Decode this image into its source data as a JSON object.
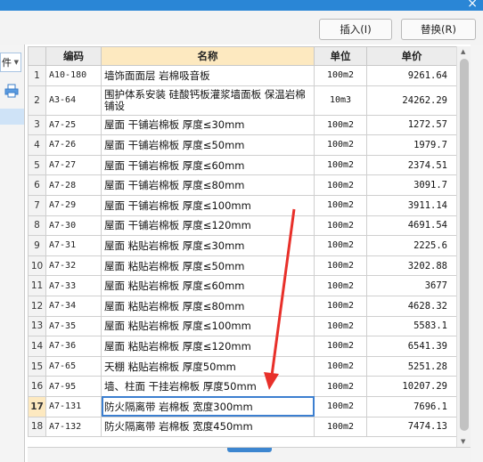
{
  "toolbar": {
    "insert_label": "插入(I)",
    "replace_label": "替换(R)"
  },
  "left_panel": {
    "dropdown_text": "件"
  },
  "table": {
    "headers": {
      "num": "",
      "code": "编码",
      "name": "名称",
      "unit": "单位",
      "price": "单价"
    },
    "rows": [
      {
        "num": "1",
        "code": "A10-180",
        "name": "墙饰面面层 岩棉吸音板",
        "unit": "100m2",
        "price": "9261.64"
      },
      {
        "num": "2",
        "code": "A3-64",
        "name": "围护体系安装 硅酸钙板灌浆墙面板 保温岩棉铺设",
        "unit": "10m3",
        "price": "24262.29"
      },
      {
        "num": "3",
        "code": "A7-25",
        "name": "屋面 干铺岩棉板 厚度≤30mm",
        "unit": "100m2",
        "price": "1272.57"
      },
      {
        "num": "4",
        "code": "A7-26",
        "name": "屋面 干铺岩棉板 厚度≤50mm",
        "unit": "100m2",
        "price": "1979.7"
      },
      {
        "num": "5",
        "code": "A7-27",
        "name": "屋面 干铺岩棉板 厚度≤60mm",
        "unit": "100m2",
        "price": "2374.51"
      },
      {
        "num": "6",
        "code": "A7-28",
        "name": "屋面 干铺岩棉板 厚度≤80mm",
        "unit": "100m2",
        "price": "3091.7"
      },
      {
        "num": "7",
        "code": "A7-29",
        "name": "屋面 干铺岩棉板 厚度≤100mm",
        "unit": "100m2",
        "price": "3911.14"
      },
      {
        "num": "8",
        "code": "A7-30",
        "name": "屋面 干铺岩棉板 厚度≤120mm",
        "unit": "100m2",
        "price": "4691.54"
      },
      {
        "num": "9",
        "code": "A7-31",
        "name": "屋面 粘贴岩棉板 厚度≤30mm",
        "unit": "100m2",
        "price": "2225.6"
      },
      {
        "num": "10",
        "code": "A7-32",
        "name": "屋面 粘贴岩棉板 厚度≤50mm",
        "unit": "100m2",
        "price": "3202.88"
      },
      {
        "num": "11",
        "code": "A7-33",
        "name": "屋面 粘贴岩棉板 厚度≤60mm",
        "unit": "100m2",
        "price": "3677"
      },
      {
        "num": "12",
        "code": "A7-34",
        "name": "屋面 粘贴岩棉板 厚度≤80mm",
        "unit": "100m2",
        "price": "4628.32"
      },
      {
        "num": "13",
        "code": "A7-35",
        "name": "屋面 粘贴岩棉板 厚度≤100mm",
        "unit": "100m2",
        "price": "5583.1"
      },
      {
        "num": "14",
        "code": "A7-36",
        "name": "屋面 粘贴岩棉板 厚度≤120mm",
        "unit": "100m2",
        "price": "6541.39"
      },
      {
        "num": "15",
        "code": "A7-65",
        "name": "天棚 粘贴岩棉板 厚度50mm",
        "unit": "100m2",
        "price": "5251.28"
      },
      {
        "num": "16",
        "code": "A7-95",
        "name": "墙、柱面 干挂岩棉板 厚度50mm",
        "unit": "100m2",
        "price": "10207.29"
      },
      {
        "num": "17",
        "code": "A7-131",
        "name": "防火隔离带 岩棉板 宽度300mm",
        "unit": "100m2",
        "price": "7696.1"
      },
      {
        "num": "18",
        "code": "A7-132",
        "name": "防火隔离带 岩棉板 宽度450mm",
        "unit": "100m2",
        "price": "7474.13"
      }
    ],
    "selected_row": "17"
  },
  "colors": {
    "titlebar": "#2a86d6",
    "header_highlight": "#fde9c0",
    "selection_border": "#3c7fd0",
    "annotation_arrow": "#e8302a"
  },
  "icons": [
    "close-icon",
    "dropdown-caret-icon",
    "printer-icon",
    "scroll-up-icon",
    "scroll-down-icon",
    "red-arrow-annotation"
  ]
}
